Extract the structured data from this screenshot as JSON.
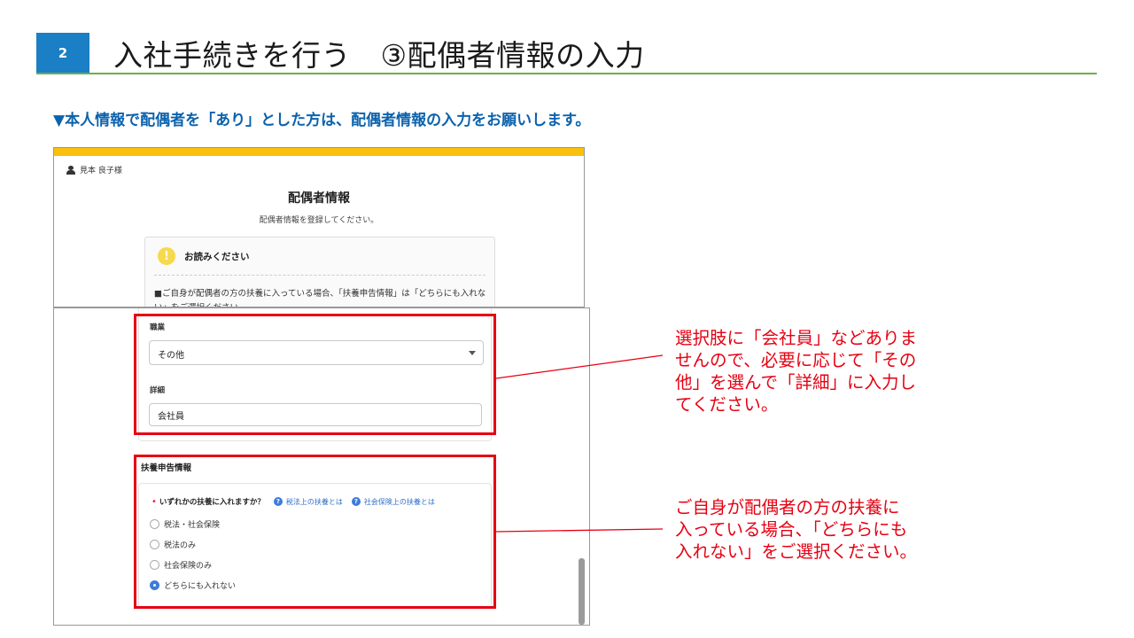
{
  "slide": {
    "step_number": "2",
    "title": "入社手続きを行う　③配偶者情報の入力",
    "subtitle": "▼本人情報で配偶者を「あり」とした方は、配偶者情報の入力をお願いします。"
  },
  "shot1": {
    "user_name": "見本 良子様",
    "heading": "配偶者情報",
    "description": "配偶者情報を登録してください。",
    "notice": {
      "title": "お読みください",
      "body": "■ご自身が配偶者の方の扶養に入っている場合、「扶養申告情報」は「どちらにも入れない」をご選択ください。"
    }
  },
  "shot2": {
    "occupation": {
      "label": "職業",
      "value": "その他"
    },
    "detail": {
      "label": "詳細",
      "value": "会社員"
    },
    "dependent_section": {
      "title": "扶養申告情報",
      "question": "いずれかの扶養に入れますか？",
      "help_links": [
        "税法上の扶養とは",
        "社会保険上の扶養とは"
      ],
      "options": [
        "税法・社会保険",
        "税法のみ",
        "社会保険のみ",
        "どちらにも入れない"
      ],
      "selected": "どちらにも入れない"
    }
  },
  "callouts": {
    "occupation_note": [
      "選択肢に「会社員」などありま",
      "せんので、必要に応じて「その",
      "他」を選んで「詳細」に入力し",
      "てください。"
    ],
    "dependent_note": [
      "ご自身が配偶者の方の扶養に",
      "入っている場合、「どちらにも",
      "入れない」をご選択ください。"
    ]
  },
  "colors": {
    "accent_blue": "#1a7fc4",
    "header_yellow": "#f9c00c",
    "title_rule_green": "#70ad47",
    "highlight_red": "#e60012"
  }
}
